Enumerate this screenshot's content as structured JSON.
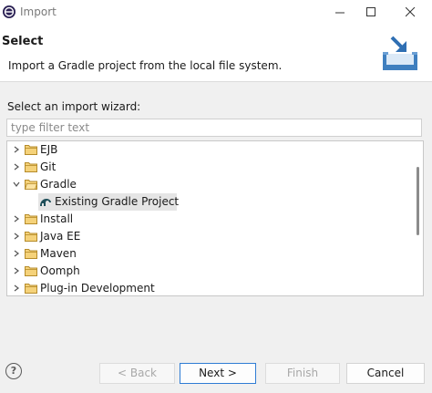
{
  "window": {
    "title": "Import"
  },
  "header": {
    "title": "Select",
    "description": "Import a Gradle project from the local file system."
  },
  "wizard_label": "Select an import wizard:",
  "filter": {
    "placeholder": "type filter text",
    "value": ""
  },
  "tree": {
    "items": [
      {
        "label": "EJB",
        "expanded": false
      },
      {
        "label": "Git",
        "expanded": false
      },
      {
        "label": "Gradle",
        "expanded": true,
        "children": [
          {
            "label": "Existing Gradle Project",
            "selected": true
          }
        ]
      },
      {
        "label": "Install",
        "expanded": false
      },
      {
        "label": "Java EE",
        "expanded": false
      },
      {
        "label": "Maven",
        "expanded": false
      },
      {
        "label": "Oomph",
        "expanded": false
      },
      {
        "label": "Plug-in Development",
        "expanded": false
      }
    ]
  },
  "buttons": {
    "help": "?",
    "back": "< Back",
    "next": "Next >",
    "finish": "Finish",
    "cancel": "Cancel"
  },
  "colors": {
    "accent": "#2f7cd4",
    "folder": "#e8b84a",
    "selection": "#e5e5e5"
  }
}
